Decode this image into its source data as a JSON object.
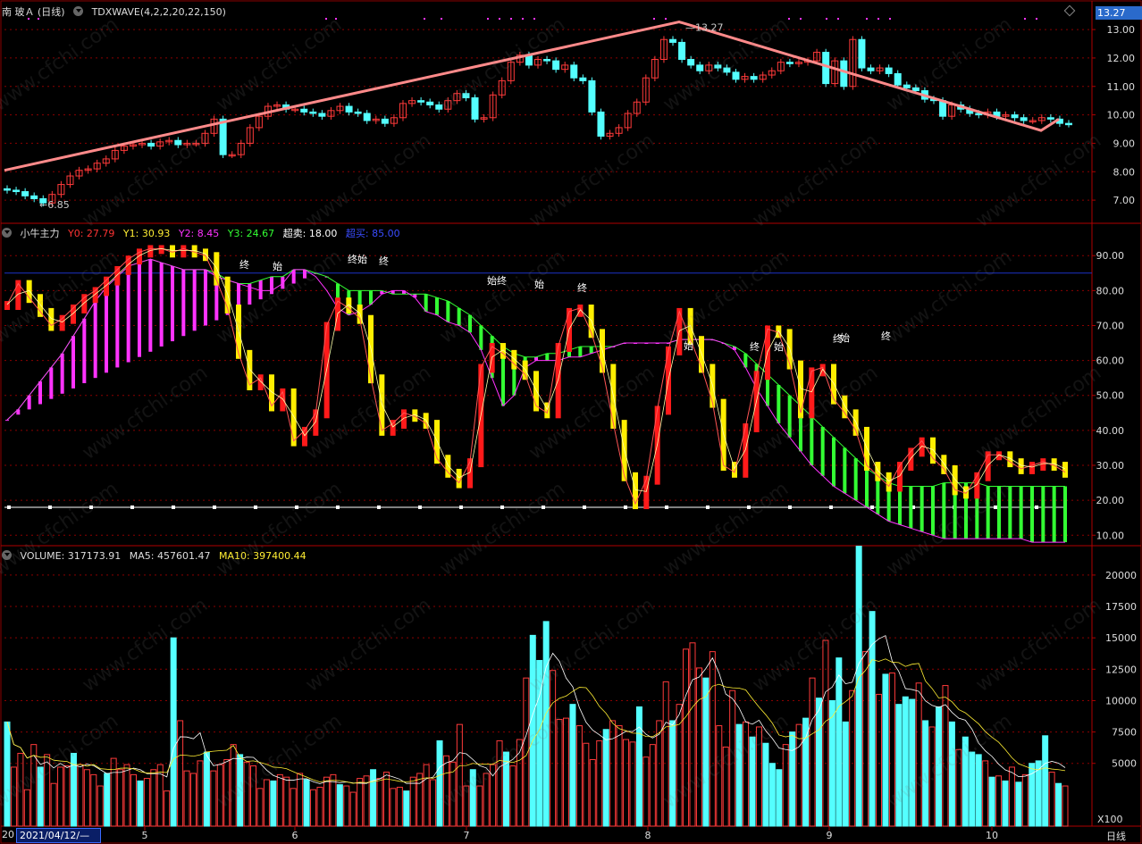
{
  "colors": {
    "up": "#ff3a3a",
    "down": "#54ffff",
    "trend": "#ff8a8a",
    "grid": "#8b0000",
    "magenta": "#ff33ff",
    "green": "#33ff33",
    "red_bar": "#ff1a1a",
    "yellow_bar": "#ffee00",
    "blue_line": "#1c32c8"
  },
  "header": {
    "stock": "南 玻Ａ (日线)",
    "indicator": "TDXWAVE(4,2,2,20,22,150)",
    "price_badge": "13.27",
    "high_label": "13.27",
    "low_label": "6.85"
  },
  "panel2": {
    "name": "小牛主力",
    "y0": "Y0: 27.79",
    "y1": "Y1: 30.93",
    "y2": "Y2: 8.45",
    "y3": "Y3: 24.67",
    "oversold": "超卖: 18.00",
    "overbought": "超买: 85.00",
    "tag_start": "始",
    "tag_end": "终"
  },
  "panel3": {
    "name": "VOLUME: 317173.91",
    "ma5": "MA5: 457601.47",
    "ma10": "MA10: 397400.44",
    "scale": "X100"
  },
  "footer": {
    "prefix": "20",
    "date": "2021/04/12/—",
    "period": "日线"
  },
  "watermark": "www.cfchi.com",
  "chart_data": [
    {
      "type": "candlestick",
      "title": "南 玻Ａ (日线)",
      "x_ticks": [
        "5",
        "6",
        "7",
        "8",
        "9",
        "10"
      ],
      "y_ticks": [
        7.0,
        8.0,
        9.0,
        10.0,
        11.0,
        12.0,
        13.0
      ],
      "ylim": [
        6.5,
        13.6
      ],
      "close": [
        7.35,
        7.3,
        7.15,
        7.05,
        6.9,
        7.2,
        7.55,
        7.85,
        8.05,
        8.1,
        8.3,
        8.45,
        8.75,
        8.9,
        8.95,
        9.0,
        8.9,
        9.05,
        9.1,
        8.95,
        9.0,
        9.0,
        9.35,
        9.85,
        8.6,
        8.6,
        9.0,
        9.55,
        9.95,
        10.3,
        10.35,
        10.2,
        10.2,
        10.1,
        10.05,
        9.95,
        10.15,
        10.3,
        10.1,
        10.05,
        9.8,
        9.85,
        9.7,
        9.9,
        10.4,
        10.5,
        10.45,
        10.35,
        10.2,
        10.5,
        10.75,
        10.6,
        9.85,
        9.9,
        10.7,
        11.2,
        11.85,
        12.1,
        11.75,
        11.95,
        11.9,
        11.6,
        11.75,
        11.3,
        11.2,
        10.1,
        9.25,
        9.35,
        9.55,
        10.05,
        10.45,
        11.3,
        11.95,
        12.65,
        12.55,
        11.95,
        11.75,
        11.55,
        11.75,
        11.65,
        11.5,
        11.25,
        11.35,
        11.25,
        11.4,
        11.55,
        11.85,
        11.8,
        11.85,
        11.9,
        12.2,
        11.1,
        11.9,
        11.0,
        12.65,
        11.65,
        11.55,
        11.65,
        11.45,
        11.05,
        10.95,
        10.85,
        10.55,
        10.5,
        9.95,
        10.35,
        10.2,
        10.05,
        10.0,
        10.1,
        9.95,
        10.0,
        9.9,
        9.8,
        9.8,
        9.9,
        9.85,
        9.7,
        9.68
      ]
    },
    {
      "type": "line",
      "title": "小牛主力",
      "y_ticks": [
        10.0,
        20.0,
        30.0,
        40.0,
        50.0,
        60.0,
        70.0,
        80.0,
        90.0
      ],
      "ylim": [
        7,
        99
      ],
      "oversold": 18,
      "overbought": 85,
      "series": [
        {
          "name": "Y0",
          "values": [
            76,
            82,
            78,
            74,
            70,
            72,
            75,
            78,
            80,
            83,
            86,
            89,
            91,
            92,
            92,
            91,
            92,
            91,
            90,
            83,
            75,
            62,
            53,
            55,
            47,
            51,
            37,
            40,
            45,
            70,
            77,
            75,
            72,
            55,
            40,
            42,
            45,
            44,
            42,
            32,
            28,
            25,
            31,
            58,
            64,
            62,
            59,
            56,
            47,
            45,
            64,
            74,
            75,
            68,
            58,
            42,
            27,
            19,
            26,
            46,
            63,
            74,
            66,
            58,
            48,
            30,
            28,
            41,
            56,
            69,
            68,
            59,
            45,
            57,
            58,
            49,
            45,
            40,
            30,
            27,
            24,
            30,
            34,
            37,
            32,
            29,
            23,
            22,
            27,
            33,
            33,
            31,
            29,
            30,
            31,
            30,
            28
          ]
        },
        {
          "name": "Y3",
          "values": [
            43,
            46,
            50,
            54,
            58,
            62,
            67,
            72,
            77,
            81,
            84,
            87,
            88,
            89,
            88,
            87,
            86,
            86,
            86,
            85,
            83,
            82,
            82,
            83,
            84,
            84,
            86,
            86,
            85,
            84,
            82,
            80,
            80,
            80,
            80,
            79,
            79,
            79,
            79,
            78,
            77,
            75,
            73,
            70,
            67,
            64,
            62,
            61,
            61,
            62,
            62,
            63,
            64,
            64,
            64,
            64,
            65,
            65,
            65,
            65,
            65,
            66,
            66,
            66,
            66,
            65,
            64,
            62,
            59,
            56,
            53,
            50,
            47,
            44,
            41,
            38,
            35,
            32,
            29,
            27,
            25,
            24,
            24,
            24,
            24,
            25,
            25,
            25,
            25,
            24,
            24,
            24,
            24,
            24,
            24,
            24,
            24
          ]
        },
        {
          "name": "Y2",
          "values": [
            43,
            46,
            50,
            54,
            58,
            62,
            67,
            72,
            77,
            81,
            84,
            87,
            88,
            89,
            88,
            87,
            86,
            86,
            86,
            84,
            83,
            82,
            81,
            80,
            80,
            82,
            86,
            86,
            84,
            80,
            75,
            73,
            74,
            76,
            79,
            80,
            80,
            78,
            74,
            73,
            71,
            70,
            68,
            63,
            55,
            47,
            50,
            58,
            60,
            60,
            60,
            61,
            61,
            62,
            63,
            64,
            65,
            65,
            65,
            65,
            65,
            66,
            66,
            66,
            66,
            65,
            63,
            58,
            52,
            47,
            42,
            38,
            34,
            30,
            27,
            24,
            22,
            20,
            18,
            16,
            14,
            13,
            12,
            11,
            10,
            9,
            9,
            9,
            9,
            9,
            9,
            9,
            9,
            8,
            8,
            8,
            8
          ]
        }
      ]
    },
    {
      "type": "bar",
      "title": "VOLUME",
      "y_ticks": [
        5000,
        7500,
        10000,
        12500,
        15000,
        17500,
        20000
      ],
      "ylim": [
        0,
        21700
      ],
      "values": [
        8300,
        4700,
        5800,
        2900,
        6500,
        4700,
        5700,
        3400,
        4700,
        4800,
        5800,
        4900,
        4500,
        4100,
        3200,
        4200,
        5400,
        4500,
        4900,
        4100,
        3600,
        3800,
        4500,
        4900,
        2800,
        15000,
        8400,
        4400,
        4200,
        5200,
        5900,
        4400,
        4900,
        5300,
        6500,
        5700,
        5100,
        4800,
        3000,
        3700,
        3600,
        4100,
        3900,
        3000,
        4200,
        3700,
        2900,
        3100,
        3900,
        4100,
        3300,
        3200,
        2700,
        3800,
        4000,
        4500,
        3800,
        4300,
        3000,
        3100,
        2800,
        3900,
        4200,
        4900,
        3700,
        6800,
        5600,
        5100,
        8100,
        3200,
        4500,
        3200,
        4200,
        4900,
        6800,
        5900,
        4800,
        6900,
        11800,
        15200,
        13200,
        16300,
        12400,
        8500,
        8600,
        9700,
        8000,
        6600,
        5300,
        6800,
        7700,
        8400,
        8000,
        6900,
        6700,
        9500,
        5500,
        6500,
        8400,
        11500,
        8400,
        9700,
        14100,
        14600,
        12600,
        11800,
        13900,
        8000,
        6300,
        10800,
        8100,
        8300,
        7100,
        7900,
        6600,
        5000,
        4500,
        6500,
        7500,
        8100,
        8600,
        11800,
        10200,
        14800,
        10000,
        13400,
        8300,
        10800,
        22300,
        13900,
        17100,
        10500,
        12100,
        12200,
        9700,
        10300,
        10100,
        11400,
        8400,
        7900,
        9500,
        11200,
        8300,
        6100,
        7100,
        5900,
        5700,
        5200,
        3900,
        4000,
        3600,
        4700,
        3500,
        4100,
        5000,
        5200,
        7200,
        4300,
        3400,
        3200
      ]
    }
  ]
}
